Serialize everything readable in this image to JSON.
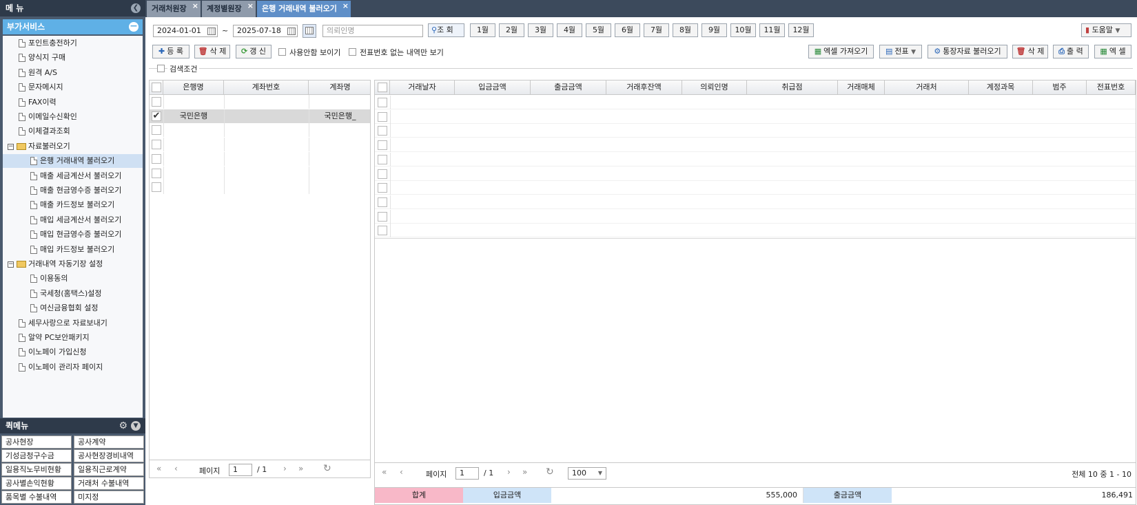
{
  "sidebar": {
    "title": "메 뉴",
    "section": "부가서비스",
    "items": [
      {
        "label": "포인트충전하기",
        "type": "file",
        "level": 1
      },
      {
        "label": "양식지 구매",
        "type": "file",
        "level": 1
      },
      {
        "label": "원격 A/S",
        "type": "file",
        "level": 1
      },
      {
        "label": "문자메시지",
        "type": "file",
        "level": 1
      },
      {
        "label": "FAX이력",
        "type": "file",
        "level": 1
      },
      {
        "label": "이메일수신확인",
        "type": "file",
        "level": 1
      },
      {
        "label": "이체결과조회",
        "type": "file",
        "level": 1
      },
      {
        "label": "자료불러오기",
        "type": "folder",
        "level": 0
      },
      {
        "label": "은행 거래내역 불러오기",
        "type": "file",
        "level": 2,
        "selected": true
      },
      {
        "label": "매출 세금계산서 불러오기",
        "type": "file",
        "level": 2
      },
      {
        "label": "매출 현금영수증 불러오기",
        "type": "file",
        "level": 2
      },
      {
        "label": "매출 카드정보 불러오기",
        "type": "file",
        "level": 2
      },
      {
        "label": "매입 세금계산서 불러오기",
        "type": "file",
        "level": 2
      },
      {
        "label": "매입 현금영수증 불러오기",
        "type": "file",
        "level": 2
      },
      {
        "label": "매입 카드정보 불러오기",
        "type": "file",
        "level": 2
      },
      {
        "label": "거래내역 자동기장 설정",
        "type": "folder",
        "level": 0
      },
      {
        "label": "이용동의",
        "type": "file",
        "level": 2
      },
      {
        "label": "국세청(홈택스)설정",
        "type": "file",
        "level": 2
      },
      {
        "label": "여신금융협회 설정",
        "type": "file",
        "level": 2
      },
      {
        "label": "세무사랑으로 자료보내기",
        "type": "file",
        "level": 1
      },
      {
        "label": "알약 PC보안패키지",
        "type": "file",
        "level": 1
      },
      {
        "label": "이노페이 가입신청",
        "type": "file",
        "level": 1
      },
      {
        "label": "이노페이 관리자 페이지",
        "type": "file",
        "level": 1
      }
    ]
  },
  "quick_menu": {
    "title": "퀵메뉴",
    "items": [
      "공사현장",
      "공사계약",
      "기성금청구수금",
      "공사현장경비내역",
      "일용직노무비현황",
      "일용직근로계약",
      "공사별손익현황",
      "거래처 수불내역",
      "품목별 수불내역",
      "미지정"
    ]
  },
  "tabs": [
    {
      "label": "거래처원장"
    },
    {
      "label": "계정별원장"
    },
    {
      "label": "은행 거래내역 불러오기",
      "active": true
    }
  ],
  "search": {
    "date_from": "2024-01-01",
    "tilde": "~",
    "date_to": "2025-07-18",
    "depositor_placeholder": "의뢰인명",
    "search_button": "조 회",
    "months": [
      "1월",
      "2월",
      "3월",
      "4월",
      "5월",
      "6월",
      "7월",
      "8월",
      "9월",
      "10월",
      "11월",
      "12월"
    ],
    "help_button": "도움말"
  },
  "toolbar": {
    "register": "등 록",
    "delete": "삭 제",
    "refresh": "갱 신",
    "show_used": "사용안함 보이기",
    "no_voucher_only": "전표번호 없는 내역만 보기",
    "excel_import": "엑셀 가져오기",
    "voucher": "전표",
    "load_passbook": "통장자료 불러오기",
    "delete2": "삭 제",
    "print": "출 력",
    "excel": "엑 셀"
  },
  "search_condition_label": "검색조건",
  "accounts_grid": {
    "columns": [
      "은행명",
      "계좌번호",
      "계좌명"
    ],
    "rows": [
      {
        "bank": "국민은행",
        "account_no": "",
        "account_name": "국민은행_",
        "checked": true
      }
    ],
    "pager": {
      "label": "페이지",
      "page": "1",
      "total": "/ 1"
    }
  },
  "transactions_grid": {
    "columns": [
      "거래날자",
      "입금금액",
      "출금금액",
      "거래후잔액",
      "의뢰인명",
      "취급점",
      "거래매체",
      "거래처",
      "계정과목",
      "범주",
      "전표번호"
    ],
    "pager": {
      "label": "페이지",
      "page": "1",
      "total": "/ 1",
      "page_size": "100",
      "summary": "전체 10 중 1 - 10"
    },
    "totals": {
      "label": "합계",
      "deposit_label": "입금금액",
      "deposit_value": "555,000",
      "withdraw_label": "출금금액",
      "withdraw_value": "186,491"
    }
  },
  "colors": {
    "sidebar_bg": "#4a5a6e",
    "active_tab": "#5f8fc8",
    "section_header": "#5fb0e6",
    "total_label_bg": "#f8b8c8",
    "total_amount_label_bg": "#cfe4f8"
  }
}
